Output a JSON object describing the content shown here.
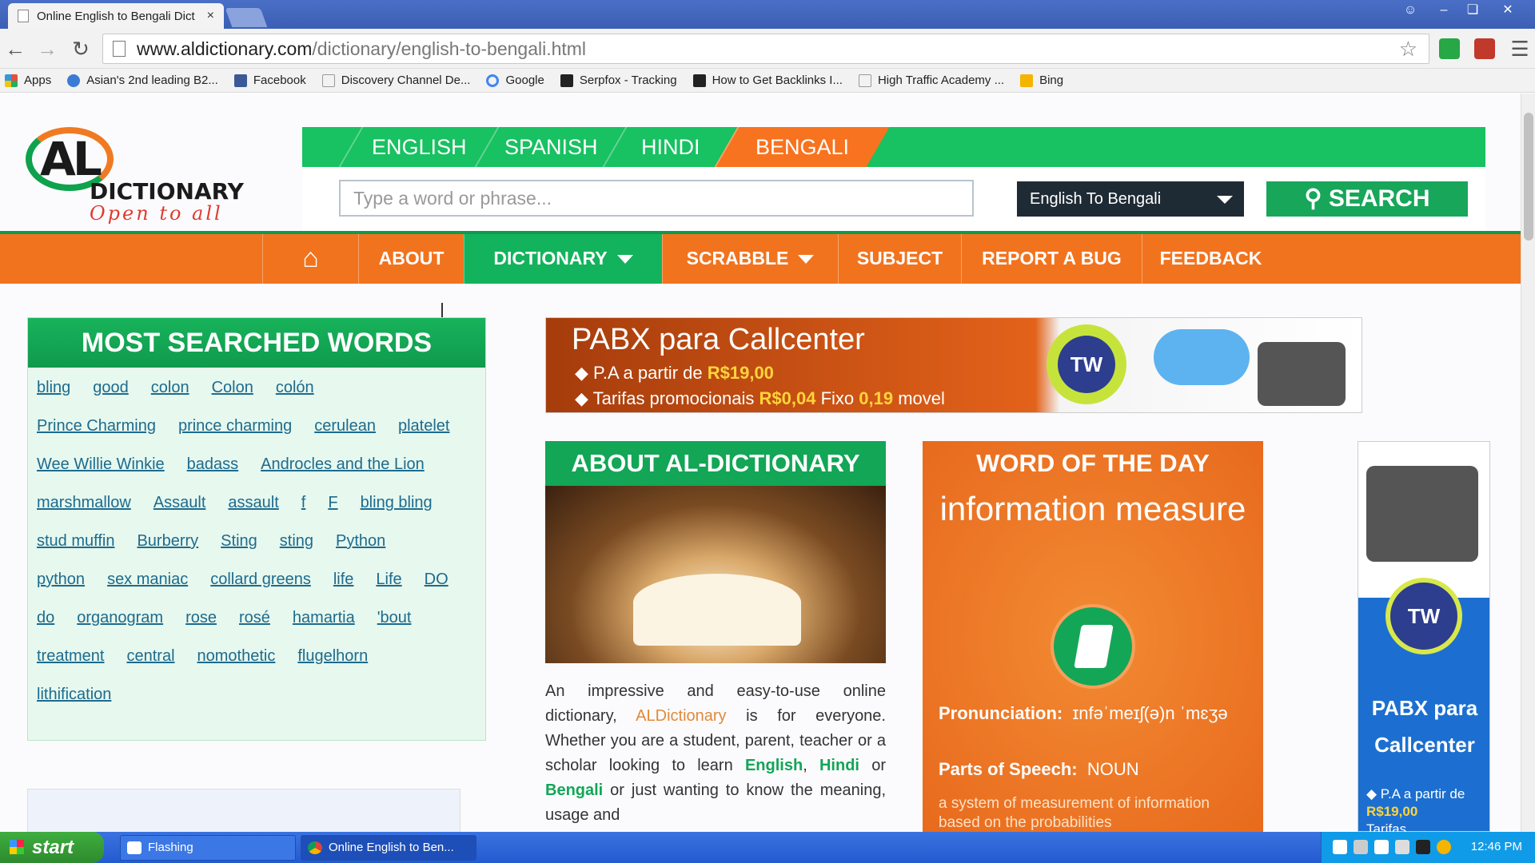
{
  "browser": {
    "tab_title": "Online English to Bengali Dict",
    "tab_close": "×",
    "url_host": "www.aldictionary.com",
    "url_path": "/dictionary/english-to-bengali.html",
    "bookmarks": [
      {
        "label": "Apps",
        "icon": "apps-grid-icon",
        "color": "#e74c3c"
      },
      {
        "label": "Asian's 2nd leading B2...",
        "icon": "globe-icon",
        "color": "#3a7bd5"
      },
      {
        "label": "Facebook",
        "icon": "facebook-icon",
        "color": "#3b5998"
      },
      {
        "label": "Discovery Channel De...",
        "icon": "page-icon",
        "color": "#ffffff"
      },
      {
        "label": "Google",
        "icon": "google-icon",
        "color": "#4285f4"
      },
      {
        "label": "Serpfox - Tracking",
        "icon": "serpfox-icon",
        "color": "#222222"
      },
      {
        "label": "How to Get Backlinks I...",
        "icon": "chart-icon",
        "color": "#222222"
      },
      {
        "label": "High Traffic Academy ...",
        "icon": "page-icon",
        "color": "#ffffff"
      },
      {
        "label": "Bing",
        "icon": "bing-icon",
        "color": "#f5b400"
      }
    ]
  },
  "site": {
    "logo_letters": "AL",
    "logo_word": "DICTIONARY",
    "logo_tagline": "Open to all",
    "languages": [
      "ENGLISH",
      "SPANISH",
      "HINDI",
      "BENGALI"
    ],
    "active_language": "BENGALI",
    "search_placeholder": "Type a word or phrase...",
    "direction_selected": "English To Bengali",
    "search_label": "SEARCH",
    "nav": {
      "about": "ABOUT",
      "dictionary": "DICTIONARY",
      "scrabble": "SCRABBLE",
      "subject": "SUBJECT",
      "report_bug": "REPORT A BUG",
      "feedback": "FEEDBACK"
    },
    "most_searched": {
      "title": "MOST SEARCHED WORDS",
      "words": [
        "bling",
        "good",
        "colon",
        "Colon",
        "colón",
        "Prince Charming",
        "prince charming",
        "cerulean",
        "platelet",
        "Wee Willie Winkie",
        "badass",
        "Androcles and the Lion",
        "marshmallow",
        "Assault",
        "assault",
        "f",
        "F",
        "bling bling",
        "stud muffin",
        "Burberry",
        "Sting",
        "sting",
        "Python",
        "python",
        "sex maniac",
        "collard greens",
        "life",
        "Life",
        "DO",
        "do",
        "organogram",
        "rose",
        "rosé",
        "hamartia",
        "'bout",
        "treatment",
        "central",
        "nomothetic",
        "flugelhorn",
        "lithification"
      ]
    },
    "ad_banner": {
      "title": "PABX para Callcenter",
      "line1_prefix": "P.A a partir de ",
      "line1_price": "R$19,00",
      "line2_prefix": "Tarifas promocionais ",
      "line2_price1": "R$0,04",
      "line2_mid": " Fixo ",
      "line2_price2": "0,19",
      "line2_suffix": " movel",
      "badge": "TW"
    },
    "about": {
      "title": "ABOUT AL-DICTIONARY",
      "text_1": "An impressive and easy-to-use online dictionary, ",
      "brand": "ALDictionary",
      "text_2": " is for everyone. Whether you are a student, parent, teacher or a scholar looking to learn ",
      "english": "English",
      "comma": ", ",
      "hindi": "Hindi",
      "or": " or ",
      "bengali": "Bengali",
      "text_3": " or just wanting to know the meaning, usage and"
    },
    "word_of_day": {
      "title": "WORD OF THE DAY",
      "word": "information measure",
      "pron_label": "Pronunciation:",
      "pron_value": "ɪnfəˈmeɪʃ(ə)n ˈmɛʒə",
      "pos_label": "Parts of Speech:",
      "pos_value": "NOUN",
      "definition": "a system of measurement of information based on the probabilities"
    },
    "side_ad": {
      "badge": "TW",
      "title": "PABX para Callcenter",
      "line1": "P.A a partir de",
      "price": "R$19,00",
      "line2": "Tarifas"
    }
  },
  "taskbar": {
    "start": "start",
    "tasks": [
      "Flashing",
      "Online English to Ben..."
    ],
    "clock": "12:46 PM"
  }
}
